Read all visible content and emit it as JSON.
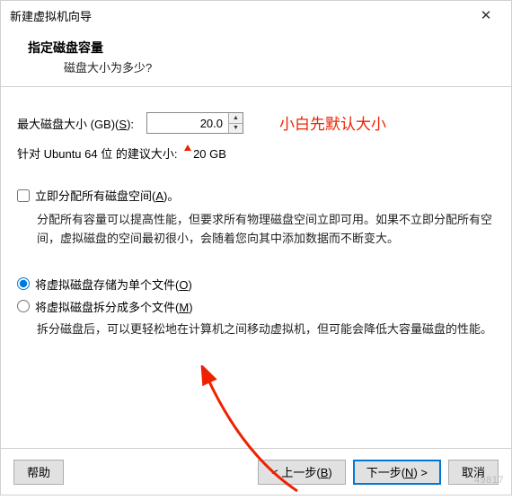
{
  "window": {
    "title": "新建虚拟机向导",
    "close": "✕"
  },
  "header": {
    "title": "指定磁盘容量",
    "subtitle": "磁盘大小为多少?"
  },
  "size": {
    "label_pre": "最大磁盘大小 (GB)(",
    "label_key": "S",
    "label_post": "):",
    "value": "20.0"
  },
  "recommend": {
    "text_pre": "针对 Ubuntu 64 位 的建议大小: ",
    "text_val": "20 GB"
  },
  "annotation": {
    "text": "小白先默认大小"
  },
  "alloc_now": {
    "label_pre": "立即分配所有磁盘空间(",
    "label_key": "A",
    "label_post": ")。",
    "desc": "分配所有容量可以提高性能，但要求所有物理磁盘空间立即可用。如果不立即分配所有空间，虚拟磁盘的空间最初很小，会随着您向其中添加数据而不断变大。"
  },
  "radio_single": {
    "label_pre": "将虚拟磁盘存储为单个文件(",
    "label_key": "O",
    "label_post": ")"
  },
  "radio_split": {
    "label_pre": "将虚拟磁盘拆分成多个文件(",
    "label_key": "M",
    "label_post": ")",
    "desc": "拆分磁盘后，可以更轻松地在计算机之间移动虚拟机，但可能会降低大容量磁盘的性能。"
  },
  "footer": {
    "help": "帮助",
    "back_pre": "< 上一步(",
    "back_key": "B",
    "back_post": ")",
    "next_pre": "下一步(",
    "next_key": "N",
    "next_post": ") >",
    "cancel": "取消"
  },
  "watermark": {
    "text": "49817"
  }
}
